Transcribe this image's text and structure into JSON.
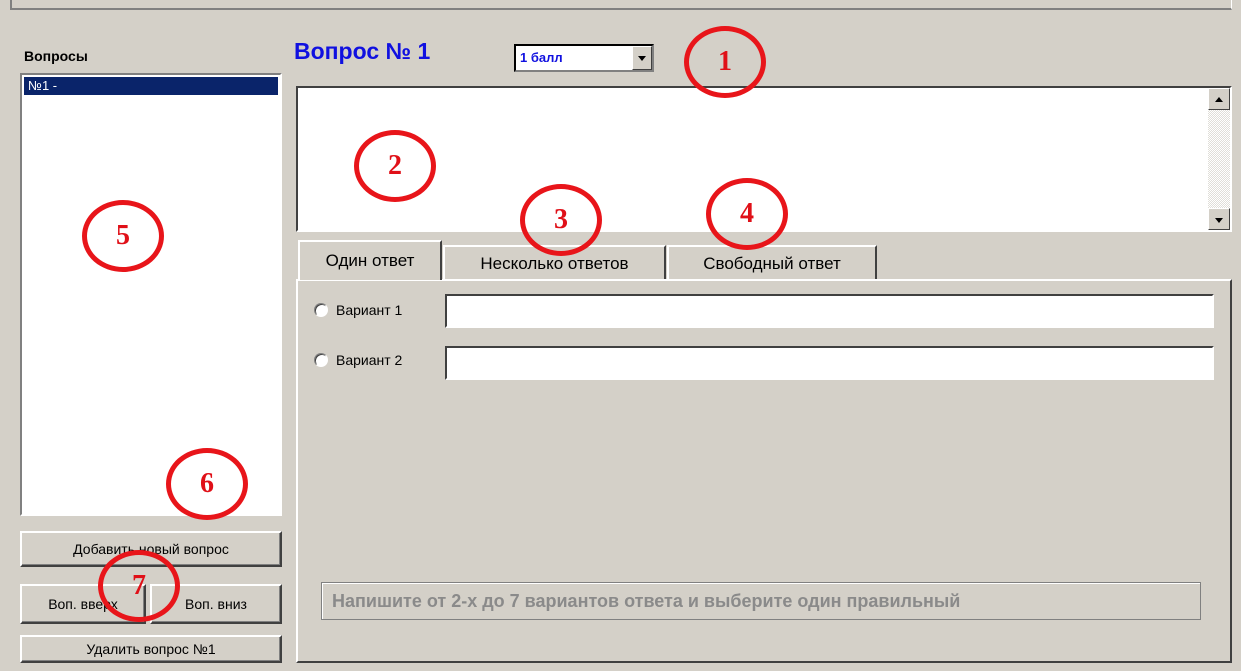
{
  "sidebar": {
    "title": "Вопросы",
    "items": [
      {
        "label": "№1 -"
      }
    ],
    "add_button": "Добавить новый вопрос",
    "up_button": "Воп. вверх",
    "down_button": "Воп. вниз",
    "delete_button": "Удалить вопрос №1"
  },
  "question": {
    "title": "Вопрос № 1",
    "score": "1 балл",
    "text": ""
  },
  "tabs": [
    {
      "label": "Один ответ",
      "active": true
    },
    {
      "label": "Несколько ответов",
      "active": false
    },
    {
      "label": "Свободный ответ",
      "active": false
    }
  ],
  "options": [
    {
      "label": "Вариант 1",
      "value": ""
    },
    {
      "label": "Вариант 2",
      "value": ""
    }
  ],
  "hint": "Напишите от 2-х до 7 вариантов ответа и выберите один правильный",
  "annotations": [
    "1",
    "2",
    "3",
    "4",
    "5",
    "6",
    "7"
  ],
  "colors": {
    "annotation": "#e8151a",
    "title": "#1010e0",
    "selection": "#0a246a",
    "window": "#d4d0c8"
  }
}
